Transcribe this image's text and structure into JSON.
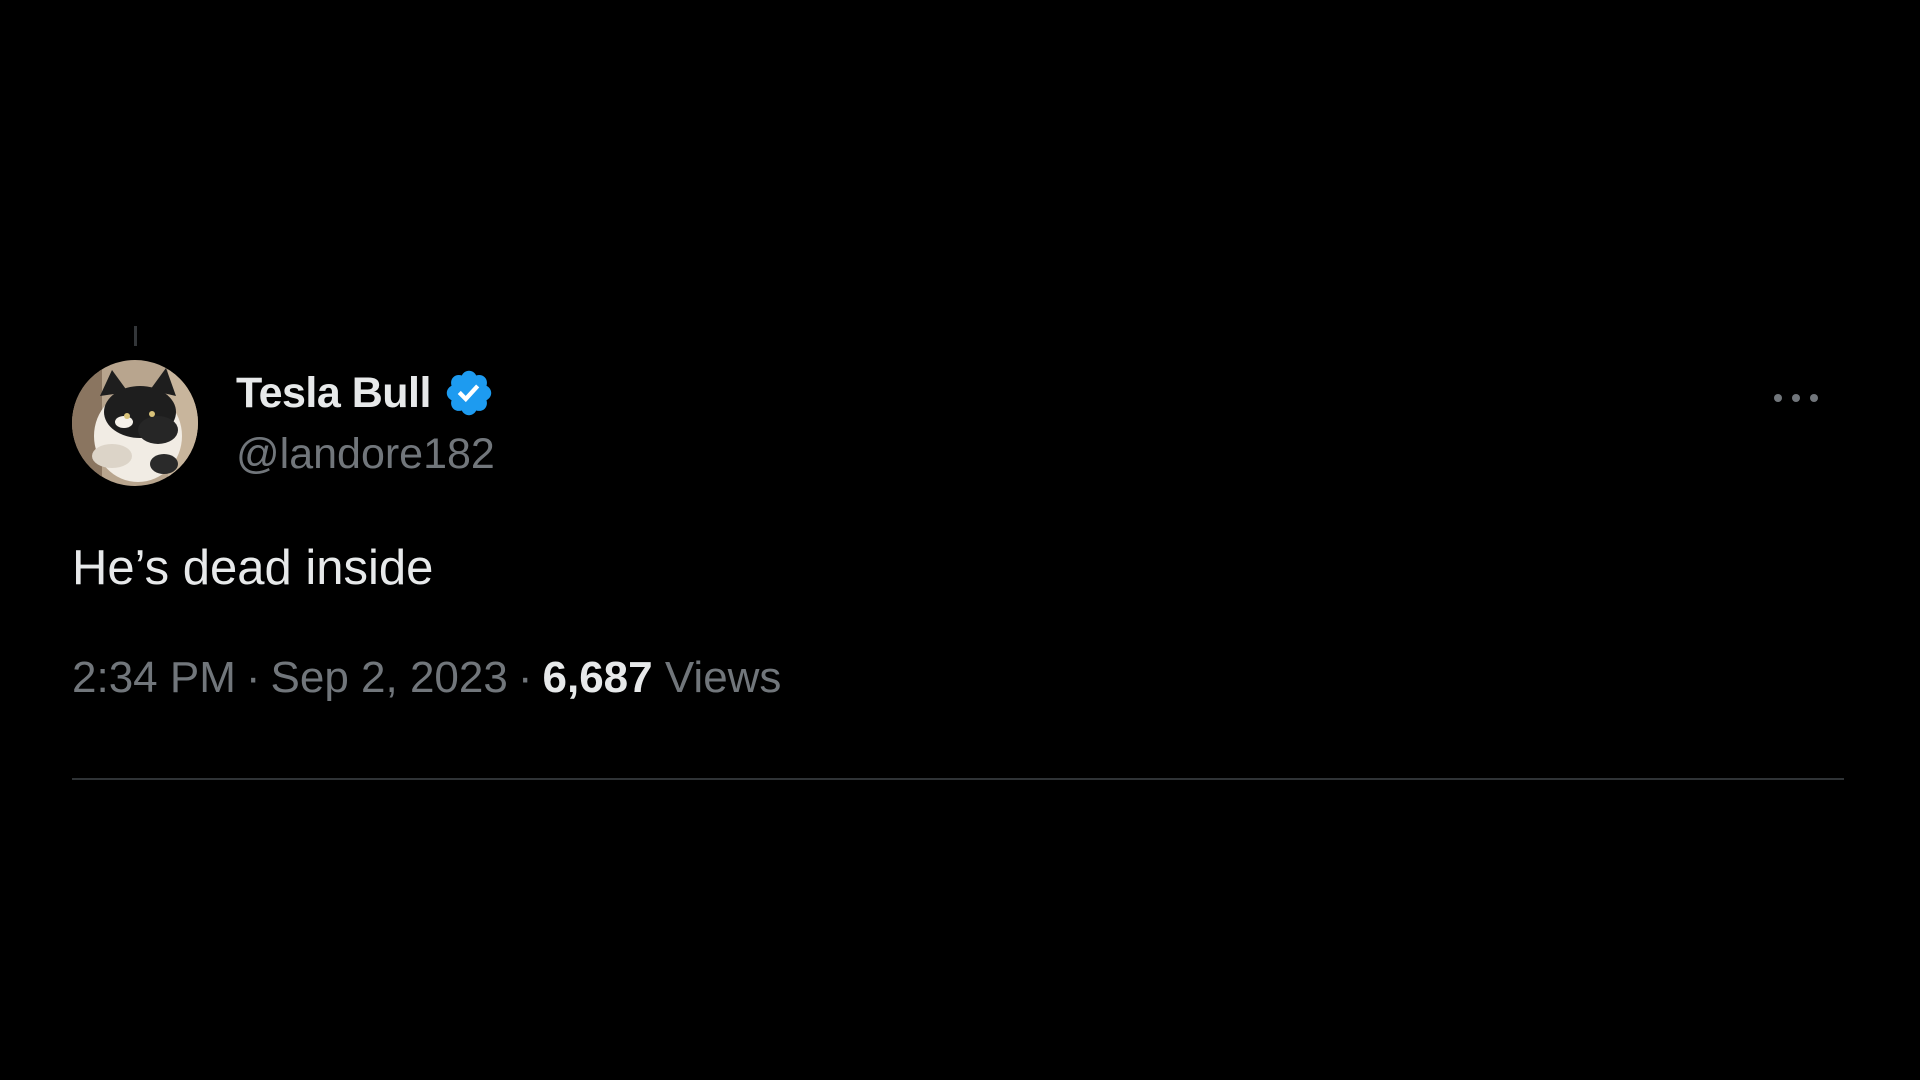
{
  "theme": {
    "background": "#000000",
    "text_primary": "#e7e9ea",
    "text_secondary": "#71767b",
    "verified_badge": "#1d9bf0",
    "divider": "#2f3336"
  },
  "tweet": {
    "author": {
      "display_name": "Tesla Bull",
      "handle": "@landore182",
      "verified": true,
      "verified_icon": "verified-badge-icon",
      "avatar_icon": "cat-avatar-image"
    },
    "more_icon": "more-options-icon",
    "text": "He’s dead inside",
    "time": "2:34 PM",
    "separator": "·",
    "date": "Sep 2, 2023",
    "views_count": "6,687",
    "views_label": "Views"
  }
}
